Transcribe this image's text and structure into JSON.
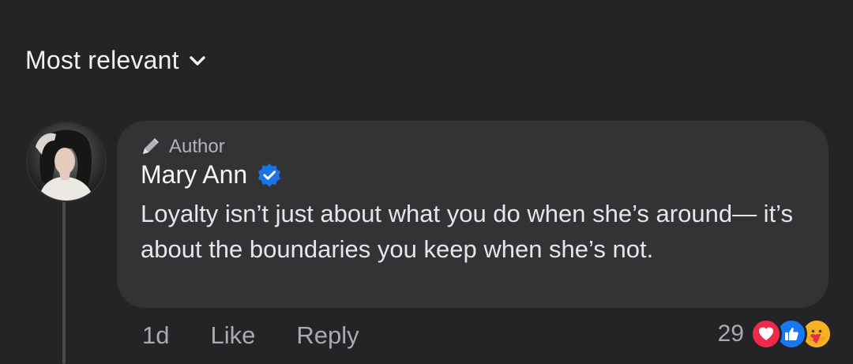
{
  "sort": {
    "label": "Most relevant",
    "icon": "chevron-down-icon"
  },
  "comment": {
    "badge_icon": "pencil-icon",
    "badge": "Author",
    "author": "Mary Ann",
    "verified_icon": "verified-badge-icon",
    "verified_color": "#1b74e4",
    "text": "Loyalty isn’t just about what you do when she’s around— it’s about the boundaries you keep when she’s not.",
    "time": "1d",
    "like_label": "Like",
    "reply_label": "Reply",
    "reaction_count": "29",
    "reactions": [
      "love-reaction-icon",
      "like-reaction-icon",
      "care-reaction-icon"
    ]
  },
  "colors": {
    "background": "#242426",
    "bubble": "#333335",
    "text": "#e4e6eb",
    "muted": "#a8abb0"
  }
}
